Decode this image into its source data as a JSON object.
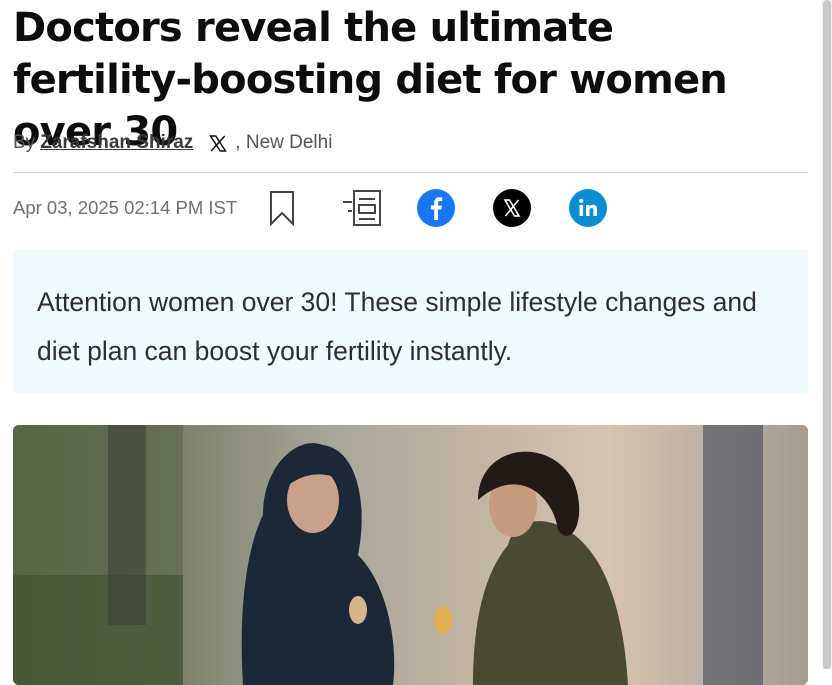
{
  "article": {
    "headline": "Doctors reveal the ultimate fertility-boosting diet for women over 30",
    "byline": {
      "by": "By",
      "author": "Zarafshan Shiraz",
      "location": ", New Delhi"
    },
    "date": "Apr 03, 2025 02:14 PM IST",
    "actions": {
      "bookmark_icon": "bookmark-icon",
      "print_icon": "print-icon",
      "share": [
        "facebook-icon",
        "x-icon",
        "linkedin-icon"
      ]
    },
    "summary": "Attention women over 30! These simple lifestyle changes and diet plan can boost your fertility instantly.",
    "hero_image": {
      "description_icon": "photo"
    }
  },
  "colors": {
    "facebook": "#1877f2",
    "x": "#000000",
    "linkedin": "#0a8ed1",
    "summary_bg": "#f0fafd"
  }
}
